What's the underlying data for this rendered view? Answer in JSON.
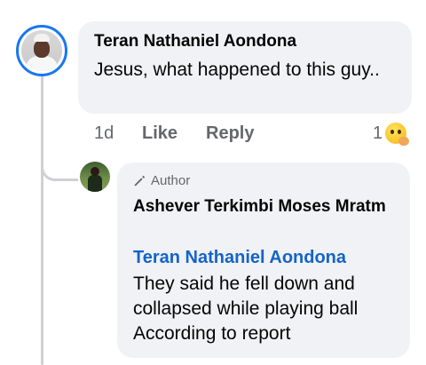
{
  "comment": {
    "author": "Teran Nathaniel Aondona",
    "text": "Jesus, what happened to this guy..",
    "time": "1d",
    "like_label": "Like",
    "reply_label": "Reply",
    "reaction_count": "1",
    "reaction_icon": "hugging-face-emoji"
  },
  "reply": {
    "badge": "Author",
    "author": "Ashever Terkimbi Moses Mratm",
    "mention": "Teran Nathaniel Aondona",
    "text": "They said he fell down and collapsed while playing ball According to report"
  },
  "colors": {
    "accent_blue": "#1877f2",
    "mention_blue": "#1464c8",
    "bubble_bg": "#f0f2f5",
    "muted_text": "#65676b",
    "thread_line": "#ced0d4"
  }
}
